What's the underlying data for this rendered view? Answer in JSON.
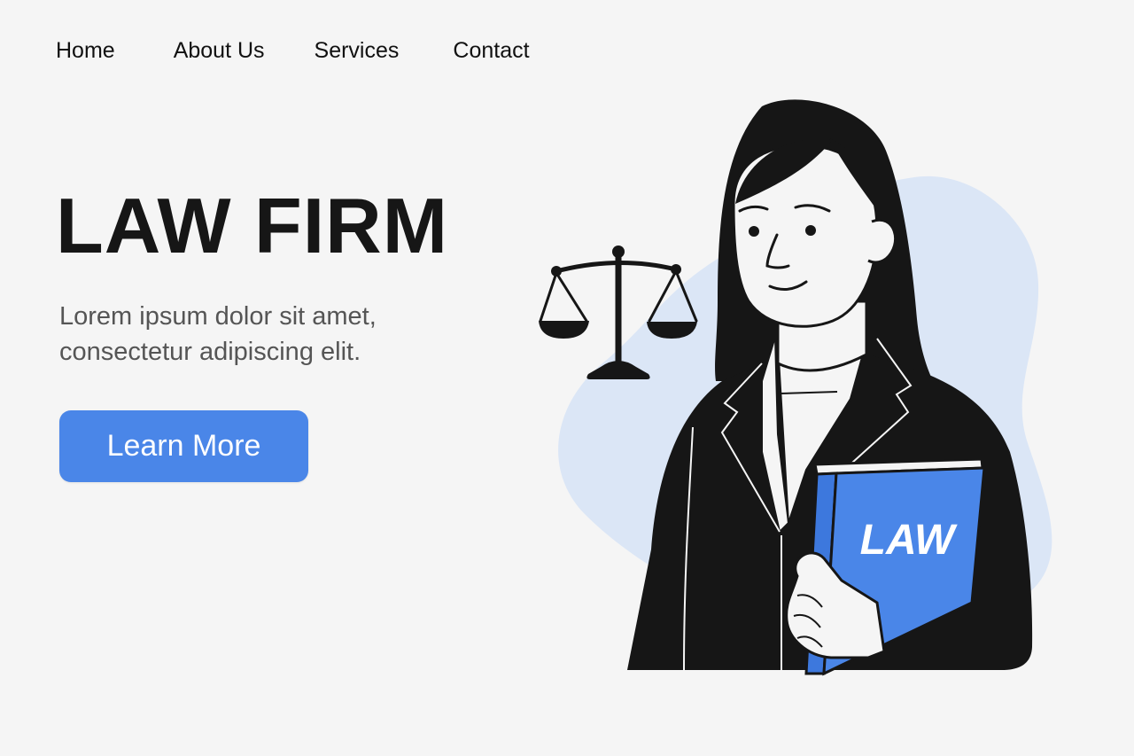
{
  "nav": {
    "items": [
      {
        "label": "Home"
      },
      {
        "label": "About Us"
      },
      {
        "label": "Services"
      },
      {
        "label": "Contact"
      }
    ]
  },
  "hero": {
    "title": "LAW FIRM",
    "subtitle": "Lorem ipsum dolor sit amet, consectetur adipiscing elit.",
    "cta_label": "Learn More"
  },
  "illustration": {
    "book_label": "LAW",
    "icons": [
      "scales-of-justice-icon",
      "lawyer-illustration",
      "law-book"
    ]
  },
  "colors": {
    "background": "#f5f5f5",
    "accent": "#4a86e8",
    "blob": "#dbe6f6",
    "text_dark": "#161616",
    "text_muted": "#555555"
  }
}
